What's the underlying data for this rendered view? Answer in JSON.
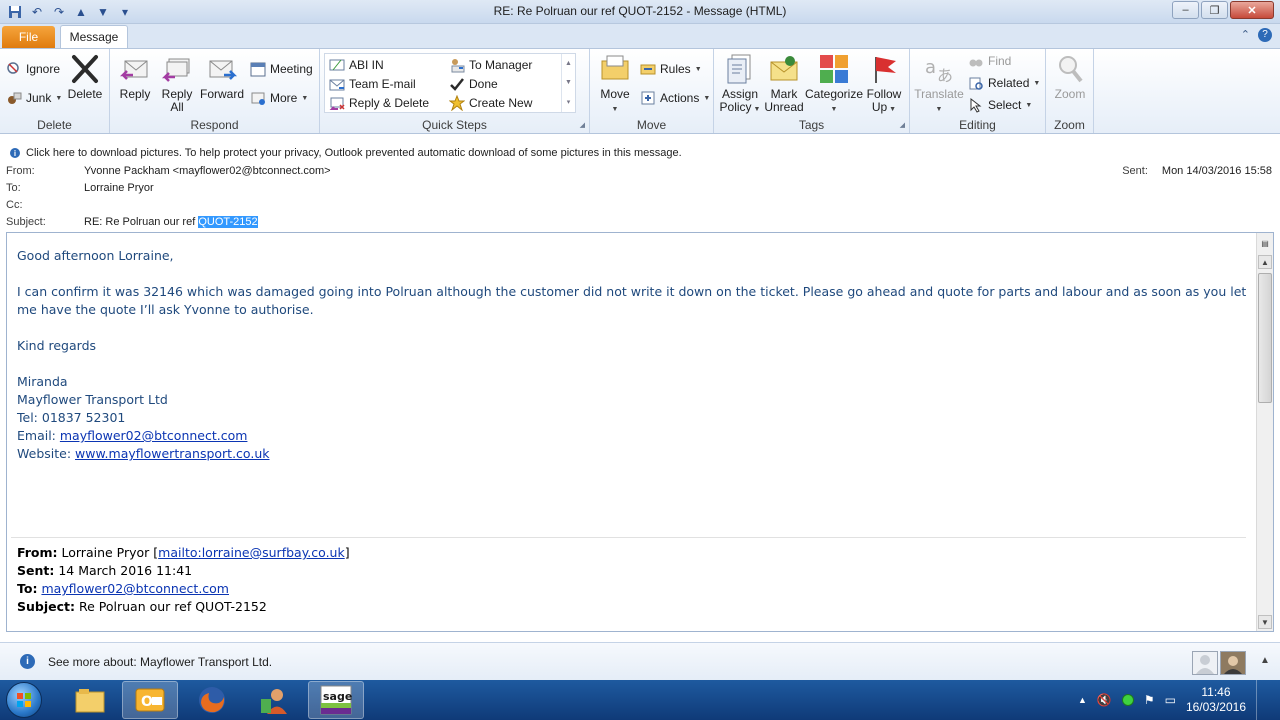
{
  "window": {
    "title": "RE: Re Polruan our ref QUOT-2152  -  Message (HTML)",
    "qat_items": [
      "outlook-icon",
      "save-icon",
      "undo-icon",
      "redo-icon",
      "previous-icon",
      "next-icon",
      "customize-icon"
    ]
  },
  "tabs": {
    "file": "File",
    "message": "Message"
  },
  "ribbon": {
    "delete_group": {
      "label": "Delete",
      "ignore": "Ignore",
      "junk": "Junk",
      "delete": "Delete"
    },
    "respond_group": {
      "label": "Respond",
      "reply": "Reply",
      "reply_all_1": "Reply",
      "reply_all_2": "All",
      "forward": "Forward",
      "meeting": "Meeting",
      "more": "More"
    },
    "quick_steps_group": {
      "label": "Quick Steps",
      "items": [
        "ABI IN",
        "To Manager",
        "Team E-mail",
        "Done",
        "Reply & Delete",
        "Create New"
      ]
    },
    "move_group": {
      "label": "Move",
      "move": "Move",
      "rules": "Rules",
      "actions": "Actions"
    },
    "tags_group": {
      "label": "Tags",
      "assign_1": "Assign",
      "assign_2": "Policy",
      "mark_1": "Mark",
      "mark_2": "Unread",
      "categorize": "Categorize",
      "follow_1": "Follow",
      "follow_2": "Up"
    },
    "editing_group": {
      "label": "Editing",
      "translate": "Translate",
      "find": "Find",
      "related": "Related",
      "select": "Select"
    },
    "zoom_group": {
      "label": "Zoom",
      "zoom": "Zoom"
    }
  },
  "infobar": {
    "text": "Click here to download pictures. To help protect your privacy, Outlook prevented automatic download of some pictures in this message."
  },
  "header": {
    "from_label": "From:",
    "from_value": "Yvonne Packham <mayflower02@btconnect.com>",
    "to_label": "To:",
    "to_value": "Lorraine Pryor",
    "cc_label": "Cc:",
    "cc_value": "",
    "subject_label": "Subject:",
    "subject_prefix": "RE: Re Polruan our ref ",
    "subject_highlight": "QUOT-2152",
    "sent_label": "Sent:",
    "sent_value": "Mon 14/03/2016 15:58"
  },
  "body": {
    "greeting": "Good afternoon Lorraine,",
    "paragraph": "I can confirm it was 32146 which was damaged going into Polruan although the customer did not write it down on the ticket.  Please go ahead and quote for parts and labour and as soon as you let me have the quote I’ll ask Yvonne to authorise.",
    "closing": "Kind regards",
    "sig_name": "Miranda",
    "sig_company": "Mayflower Transport Ltd",
    "sig_tel": "Tel: 01837 52301",
    "sig_email_label": "Email: ",
    "sig_email": "mayflower02@btconnect.com",
    "sig_web_label": "Website: ",
    "sig_web": "www.mayflowertransport.co.uk"
  },
  "quoted": {
    "from_label": "From:",
    "from_name": " Lorraine Pryor [",
    "from_link": "mailto:lorraine@surfbay.co.uk",
    "from_end": "]",
    "sent_label": "Sent:",
    "sent_value": " 14 March 2016 11:41",
    "to_label": "To:",
    "to_link": "mayflower02@btconnect.com",
    "subject_label": "Subject:",
    "subject_value": " Re Polruan our ref QUOT-2152"
  },
  "people_pane": {
    "text": "See more about: Mayflower Transport Ltd."
  },
  "taskbar": {
    "apps": [
      "file-explorer-icon",
      "outlook-icon",
      "firefox-icon",
      "contacts-app-icon",
      "sage-icon"
    ],
    "sage_label": "sage",
    "time": "11:46",
    "date": "16/03/2016"
  },
  "colors": {
    "accent": "#2d6ab7",
    "file_tab": "#e07b0f",
    "body_text": "#1f497d",
    "highlight": "#3399ff",
    "taskbar": "#1a4f8f"
  }
}
